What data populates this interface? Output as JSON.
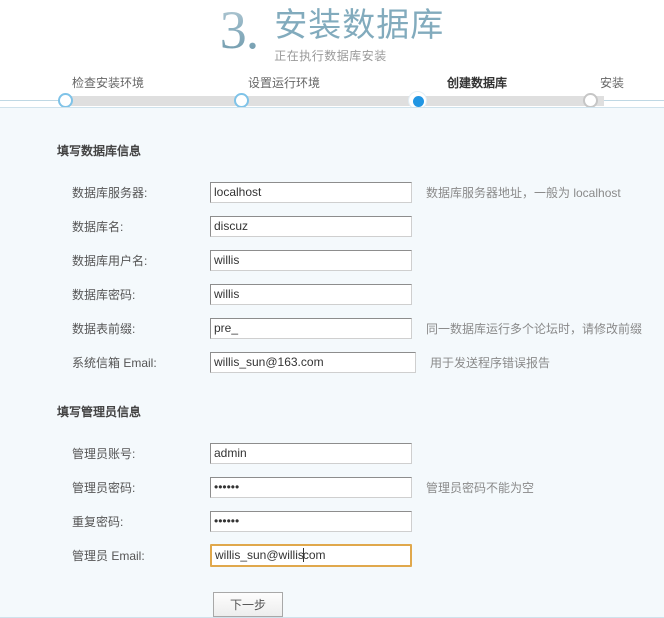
{
  "header": {
    "step_number": "3.",
    "title": "安装数据库",
    "subtitle": "正在执行数据库安装"
  },
  "steps": [
    {
      "label": "检查安装环境",
      "state": "done"
    },
    {
      "label": "设置运行环境",
      "state": "done"
    },
    {
      "label": "创建数据库",
      "state": "active"
    },
    {
      "label": "安装",
      "state": "pending"
    }
  ],
  "db_section": {
    "title": "填写数据库信息",
    "rows": [
      {
        "label": "数据库服务器:",
        "value": "localhost",
        "hint": "数据库服务器地址，一般为 localhost",
        "type": "text"
      },
      {
        "label": "数据库名:",
        "value": "discuz",
        "hint": "",
        "type": "text"
      },
      {
        "label": "数据库用户名:",
        "value": "willis",
        "hint": "",
        "type": "text"
      },
      {
        "label": "数据库密码:",
        "value": "willis",
        "hint": "",
        "type": "text"
      },
      {
        "label": "数据表前缀:",
        "value": "pre_",
        "hint": "同一数据库运行多个论坛时，请修改前缀",
        "type": "text"
      },
      {
        "label": "系统信箱 Email:",
        "value": "willis_sun@163.com",
        "hint": "用于发送程序错误报告",
        "type": "text"
      }
    ]
  },
  "admin_section": {
    "title": "填写管理员信息",
    "rows": [
      {
        "label": "管理员账号:",
        "value": "admin",
        "hint": "",
        "type": "text"
      },
      {
        "label": "管理员密码:",
        "value": "••••••",
        "hint": "管理员密码不能为空",
        "type": "password"
      },
      {
        "label": "重复密码:",
        "value": "••••••",
        "hint": "",
        "type": "password"
      },
      {
        "label": "管理员 Email:",
        "value_before_caret": "willis_sun@willis",
        "value_after_caret": "com",
        "hint": "",
        "type": "text-focused"
      }
    ]
  },
  "footer": {
    "next_label": "下一步"
  },
  "colors": {
    "accent": "#82abbd",
    "active_dot": "#2196e3",
    "step_dot": "#7fc3e8",
    "focus_border": "#e0a84c",
    "page_bg": "#f4f9fc"
  }
}
